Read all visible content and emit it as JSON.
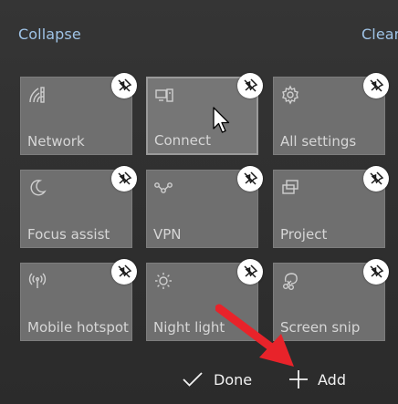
{
  "header": {
    "collapse_label": "Collapse",
    "clear_label": "Clear"
  },
  "tiles": [
    {
      "label": "Network",
      "icon": "network-icon"
    },
    {
      "label": "Connect",
      "icon": "connect-icon"
    },
    {
      "label": "All settings",
      "icon": "gear-icon"
    },
    {
      "label": "Focus assist",
      "icon": "moon-icon"
    },
    {
      "label": "VPN",
      "icon": "vpn-icon"
    },
    {
      "label": "Project",
      "icon": "project-icon"
    },
    {
      "label": "Mobile hotspot",
      "icon": "hotspot-icon"
    },
    {
      "label": "Night light",
      "icon": "sun-icon"
    },
    {
      "label": "Screen snip",
      "icon": "snip-icon"
    }
  ],
  "pin_icon": "unpin-icon",
  "footer": {
    "done_label": "Done",
    "add_label": "Add"
  },
  "colors": {
    "background": "#2e2e2e",
    "tile": "#6f6f6f",
    "link": "#9fc3e6",
    "arrow": "#e8232a"
  }
}
